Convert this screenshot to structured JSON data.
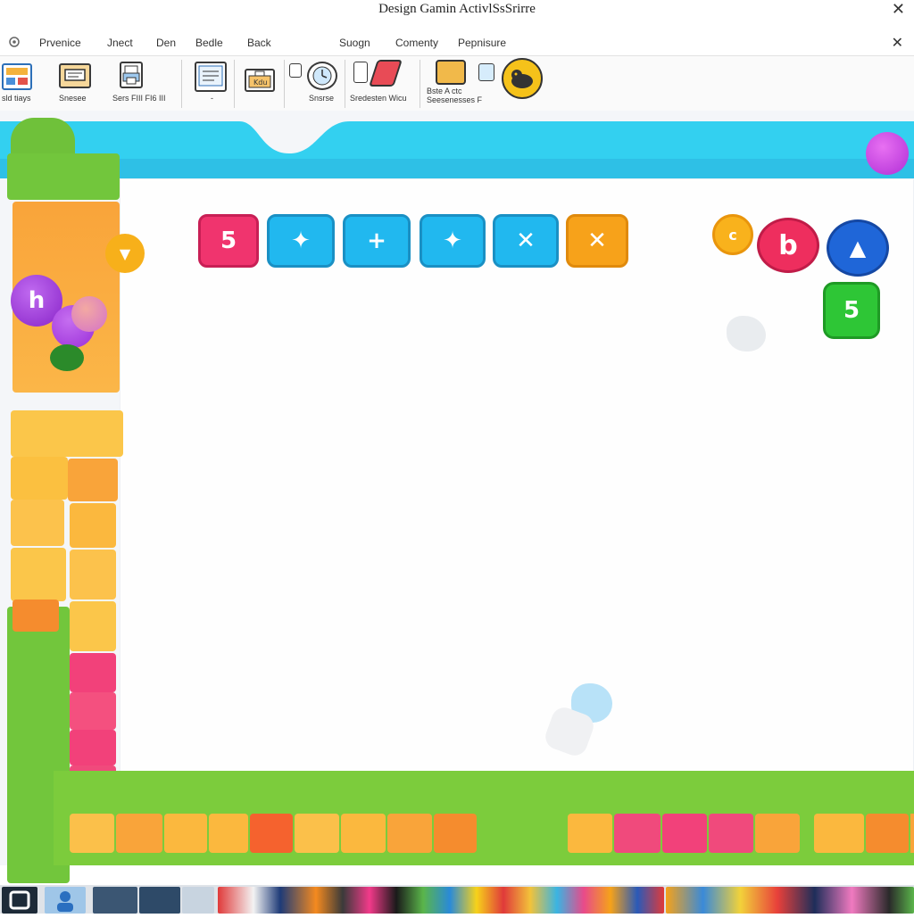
{
  "window": {
    "title": "Design Gamin ActivlSsSrirre",
    "close_glyph": "✕"
  },
  "menu": {
    "items": [
      "Prvenice",
      "Jnect",
      "Den",
      "Bedle",
      "Back",
      "Suogn",
      "Comenty",
      "Pepnisure"
    ],
    "close_glyph": "✕"
  },
  "ribbon": {
    "labels": [
      "sld tiays",
      "Snesee",
      "Sers FIII FI6 III",
      "-",
      "Snsrse",
      "Sredesten Wicu",
      "Bste A ctc Seesenesses F"
    ],
    "tool_icons": [
      "template-icon",
      "window-icon",
      "printer-icon",
      "document-icon",
      "briefcase-icon",
      "camera-icon",
      "alarm-icon",
      "cards-icon",
      "brush-icon",
      "stack-icon",
      "pen-icon",
      "rubber-duck-icon"
    ]
  },
  "game": {
    "buttons": [
      {
        "glyph": "5",
        "color": "#f0346e"
      },
      {
        "glyph": "✦",
        "color": "#21b8ef"
      },
      {
        "glyph": "+",
        "color": "#21b8ef"
      },
      {
        "glyph": "✦",
        "color": "#21b8ef"
      },
      {
        "glyph": "✕",
        "color": "#21b8ef"
      },
      {
        "glyph": "✕",
        "color": "#f7a21a"
      }
    ],
    "badges": {
      "small_coin": "c",
      "red_round": "b",
      "blue_round": "▲",
      "green_square": "5",
      "purple_disc": "h"
    },
    "colors": {
      "cyan": "#33d0f0",
      "green": "#7ccc3c",
      "orange": "#f9a43a",
      "yellow": "#fbc64a",
      "pink": "#f2417a",
      "purple": "#a23ee0"
    }
  },
  "taskbar": {
    "icons": [
      "start-icon",
      "user-icon",
      "map-icon",
      "browser-icon",
      "file-icon",
      "media-icon",
      "gallery-icon"
    ]
  }
}
